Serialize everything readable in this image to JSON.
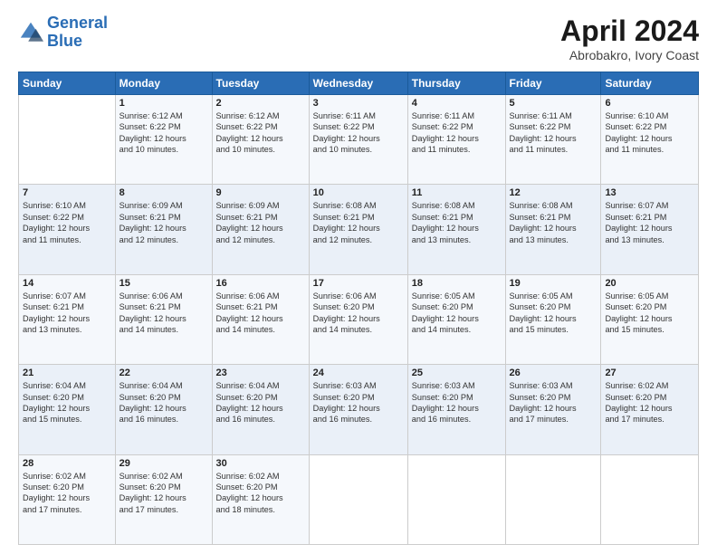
{
  "header": {
    "logo_line1": "General",
    "logo_line2": "Blue",
    "main_title": "April 2024",
    "sub_title": "Abrobakro, Ivory Coast"
  },
  "weekdays": [
    "Sunday",
    "Monday",
    "Tuesday",
    "Wednesday",
    "Thursday",
    "Friday",
    "Saturday"
  ],
  "weeks": [
    [
      {
        "day": "",
        "info": ""
      },
      {
        "day": "1",
        "info": "Sunrise: 6:12 AM\nSunset: 6:22 PM\nDaylight: 12 hours\nand 10 minutes."
      },
      {
        "day": "2",
        "info": "Sunrise: 6:12 AM\nSunset: 6:22 PM\nDaylight: 12 hours\nand 10 minutes."
      },
      {
        "day": "3",
        "info": "Sunrise: 6:11 AM\nSunset: 6:22 PM\nDaylight: 12 hours\nand 10 minutes."
      },
      {
        "day": "4",
        "info": "Sunrise: 6:11 AM\nSunset: 6:22 PM\nDaylight: 12 hours\nand 11 minutes."
      },
      {
        "day": "5",
        "info": "Sunrise: 6:11 AM\nSunset: 6:22 PM\nDaylight: 12 hours\nand 11 minutes."
      },
      {
        "day": "6",
        "info": "Sunrise: 6:10 AM\nSunset: 6:22 PM\nDaylight: 12 hours\nand 11 minutes."
      }
    ],
    [
      {
        "day": "7",
        "info": "Sunrise: 6:10 AM\nSunset: 6:22 PM\nDaylight: 12 hours\nand 11 minutes."
      },
      {
        "day": "8",
        "info": "Sunrise: 6:09 AM\nSunset: 6:21 PM\nDaylight: 12 hours\nand 12 minutes."
      },
      {
        "day": "9",
        "info": "Sunrise: 6:09 AM\nSunset: 6:21 PM\nDaylight: 12 hours\nand 12 minutes."
      },
      {
        "day": "10",
        "info": "Sunrise: 6:08 AM\nSunset: 6:21 PM\nDaylight: 12 hours\nand 12 minutes."
      },
      {
        "day": "11",
        "info": "Sunrise: 6:08 AM\nSunset: 6:21 PM\nDaylight: 12 hours\nand 13 minutes."
      },
      {
        "day": "12",
        "info": "Sunrise: 6:08 AM\nSunset: 6:21 PM\nDaylight: 12 hours\nand 13 minutes."
      },
      {
        "day": "13",
        "info": "Sunrise: 6:07 AM\nSunset: 6:21 PM\nDaylight: 12 hours\nand 13 minutes."
      }
    ],
    [
      {
        "day": "14",
        "info": "Sunrise: 6:07 AM\nSunset: 6:21 PM\nDaylight: 12 hours\nand 13 minutes."
      },
      {
        "day": "15",
        "info": "Sunrise: 6:06 AM\nSunset: 6:21 PM\nDaylight: 12 hours\nand 14 minutes."
      },
      {
        "day": "16",
        "info": "Sunrise: 6:06 AM\nSunset: 6:21 PM\nDaylight: 12 hours\nand 14 minutes."
      },
      {
        "day": "17",
        "info": "Sunrise: 6:06 AM\nSunset: 6:20 PM\nDaylight: 12 hours\nand 14 minutes."
      },
      {
        "day": "18",
        "info": "Sunrise: 6:05 AM\nSunset: 6:20 PM\nDaylight: 12 hours\nand 14 minutes."
      },
      {
        "day": "19",
        "info": "Sunrise: 6:05 AM\nSunset: 6:20 PM\nDaylight: 12 hours\nand 15 minutes."
      },
      {
        "day": "20",
        "info": "Sunrise: 6:05 AM\nSunset: 6:20 PM\nDaylight: 12 hours\nand 15 minutes."
      }
    ],
    [
      {
        "day": "21",
        "info": "Sunrise: 6:04 AM\nSunset: 6:20 PM\nDaylight: 12 hours\nand 15 minutes."
      },
      {
        "day": "22",
        "info": "Sunrise: 6:04 AM\nSunset: 6:20 PM\nDaylight: 12 hours\nand 16 minutes."
      },
      {
        "day": "23",
        "info": "Sunrise: 6:04 AM\nSunset: 6:20 PM\nDaylight: 12 hours\nand 16 minutes."
      },
      {
        "day": "24",
        "info": "Sunrise: 6:03 AM\nSunset: 6:20 PM\nDaylight: 12 hours\nand 16 minutes."
      },
      {
        "day": "25",
        "info": "Sunrise: 6:03 AM\nSunset: 6:20 PM\nDaylight: 12 hours\nand 16 minutes."
      },
      {
        "day": "26",
        "info": "Sunrise: 6:03 AM\nSunset: 6:20 PM\nDaylight: 12 hours\nand 17 minutes."
      },
      {
        "day": "27",
        "info": "Sunrise: 6:02 AM\nSunset: 6:20 PM\nDaylight: 12 hours\nand 17 minutes."
      }
    ],
    [
      {
        "day": "28",
        "info": "Sunrise: 6:02 AM\nSunset: 6:20 PM\nDaylight: 12 hours\nand 17 minutes."
      },
      {
        "day": "29",
        "info": "Sunrise: 6:02 AM\nSunset: 6:20 PM\nDaylight: 12 hours\nand 17 minutes."
      },
      {
        "day": "30",
        "info": "Sunrise: 6:02 AM\nSunset: 6:20 PM\nDaylight: 12 hours\nand 18 minutes."
      },
      {
        "day": "",
        "info": ""
      },
      {
        "day": "",
        "info": ""
      },
      {
        "day": "",
        "info": ""
      },
      {
        "day": "",
        "info": ""
      }
    ]
  ]
}
